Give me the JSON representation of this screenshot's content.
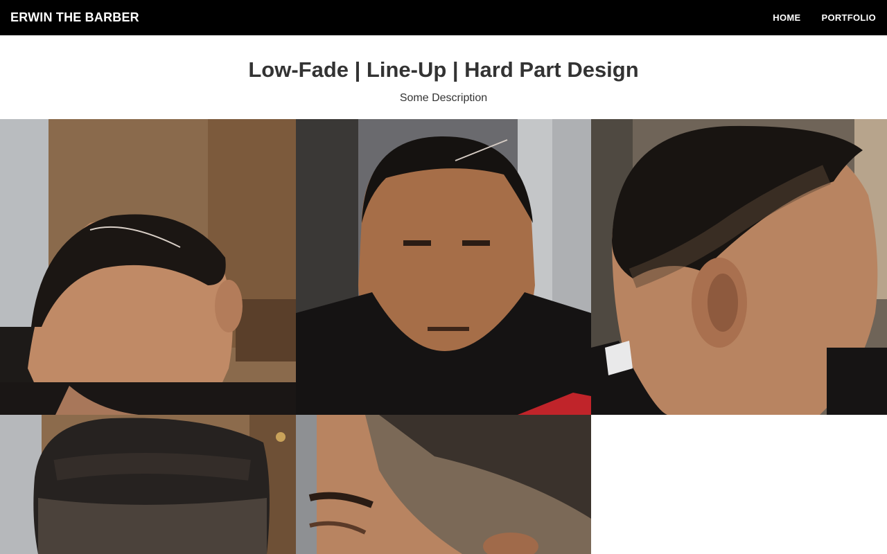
{
  "navbar": {
    "brand": "ERWIN THE BARBER",
    "links": [
      {
        "label": "HOME"
      },
      {
        "label": "PORTFOLIO"
      }
    ]
  },
  "header": {
    "title": "Low-Fade | Line-Up | Hard Part Design",
    "description": "Some Description"
  },
  "gallery": {
    "photos": [
      {
        "subject": "left-three-quarter-view-hard-part"
      },
      {
        "subject": "front-view-line-up"
      },
      {
        "subject": "right-side-view-low-fade"
      },
      {
        "subject": "top-back-view"
      },
      {
        "subject": "side-close-up-fade"
      }
    ]
  },
  "colors": {
    "navbar_bg": "#000000",
    "navbar_text": "#ffffff",
    "text": "#333333"
  }
}
